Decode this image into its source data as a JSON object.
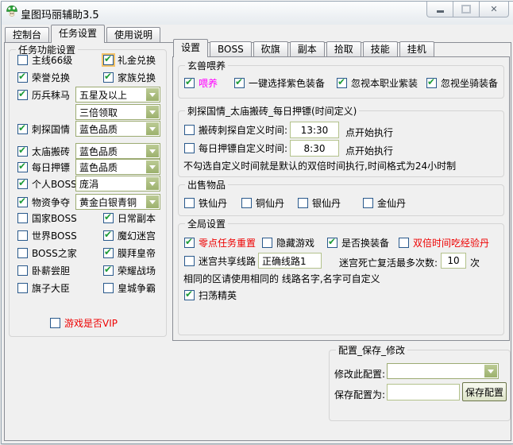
{
  "window": {
    "title": "皇图玛丽辅助3.5"
  },
  "icons": {
    "minimize": "minimize",
    "maximize": "maximize",
    "close": "close",
    "check": "✔",
    "chevron": "▾",
    "app": "mushroom"
  },
  "colors": {
    "check_green": "#1d9b38",
    "combo_border": "#9cab72",
    "combo_button": "#a9bc80",
    "red_text": "#ee0000",
    "magenta_text": "#ff00ff",
    "focus_orange": "#f4c369"
  },
  "main_tabs": {
    "items": [
      "控制台",
      "任务设置",
      "使用说明"
    ],
    "active": "任务设置"
  },
  "left": {
    "title": "任务功能设置",
    "checks": [
      {
        "label": "主线66级",
        "checked": false
      },
      {
        "label": "礼金兑换",
        "checked": true,
        "focused": true
      },
      {
        "label": "荣誉兑换",
        "checked": true
      },
      {
        "label": "家族兑换",
        "checked": true
      },
      {
        "label": "国家BOSS",
        "checked": false
      },
      {
        "label": "日常副本",
        "checked": true
      },
      {
        "label": "世界BOSS",
        "checked": false
      },
      {
        "label": "魔幻迷宫",
        "checked": true
      },
      {
        "label": "BOSS之家",
        "checked": false
      },
      {
        "label": "膜拜皇帝",
        "checked": true
      },
      {
        "label": "卧薪尝胆",
        "checked": false
      },
      {
        "label": "荣耀战场",
        "checked": true
      },
      {
        "label": "旗子大臣",
        "checked": false
      },
      {
        "label": "皇城争霸",
        "checked": false
      }
    ],
    "combos": [
      {
        "label": "历兵秣马",
        "checked": true,
        "value": "五星及以上"
      },
      {
        "label": "",
        "value": "三倍领取"
      },
      {
        "label": "刺探国情",
        "checked": true,
        "value": "蓝色品质"
      },
      {
        "label": "太庙搬砖",
        "checked": true,
        "value": "蓝色品质"
      },
      {
        "label": "每日押镖",
        "checked": true,
        "value": "蓝色品质"
      },
      {
        "label": "个人BOSS",
        "checked": true,
        "value": "庞涓"
      },
      {
        "label": "物资争夺",
        "checked": true,
        "value": "黄金白银青铜"
      }
    ],
    "vip": {
      "label": "游戏是否VIP",
      "checked": false
    }
  },
  "right_tabs": {
    "items": [
      "设置",
      "BOSS",
      "砍旗",
      "副本",
      "拾取",
      "技能",
      "挂机"
    ],
    "active": "设置"
  },
  "feed_group": {
    "title": "玄兽喂养",
    "items": [
      {
        "label": "喂养",
        "checked": true,
        "magenta": true
      },
      {
        "label": "一键选择紫色装备",
        "checked": true
      },
      {
        "label": "忽视本职业紫装",
        "checked": true
      },
      {
        "label": "忽视坐骑装备",
        "checked": true
      }
    ]
  },
  "time_group": {
    "title": "刺探国情_太庙搬砖_每日押镖(时间定义)",
    "rows": [
      {
        "label": "搬砖刺探自定义时间:",
        "checked": false,
        "value": "13:30",
        "suffix": "点开始执行"
      },
      {
        "label": "每日押镖自定义时间:",
        "checked": false,
        "value": "8:30",
        "suffix": "点开始执行"
      }
    ],
    "note": "不勾选自定义时间就是默认的双倍时间执行,时间格式为24小时制"
  },
  "sell_group": {
    "title": "出售物品",
    "items": [
      {
        "label": "铁仙丹",
        "checked": false
      },
      {
        "label": "铜仙丹",
        "checked": false
      },
      {
        "label": "银仙丹",
        "checked": false
      },
      {
        "label": "金仙丹",
        "checked": false
      }
    ]
  },
  "global_group": {
    "title": "全局设置",
    "row1": [
      {
        "label": "零点任务重置",
        "checked": true,
        "red": true
      },
      {
        "label": "隐藏游戏",
        "checked": false
      },
      {
        "label": "是否换装备",
        "checked": true
      },
      {
        "label": "双倍时间吃经验丹",
        "checked": false,
        "red": true
      }
    ],
    "maze": {
      "label": "迷宫共享线路",
      "checked": false,
      "value": "正确线路1",
      "death_label": "迷宫死亡复活最多次数:",
      "death_value": "10",
      "death_suffix": "次"
    },
    "note": "相同的区请使用相同的 线路名字,名字可自定义",
    "sweep": {
      "label": "扫荡精英",
      "checked": true
    }
  },
  "config_group": {
    "title": "配置_保存_修改",
    "modify_label": "修改此配置:",
    "modify_value": "",
    "save_label": "保存配置为:",
    "save_value": "",
    "save_button": "保存配置"
  }
}
